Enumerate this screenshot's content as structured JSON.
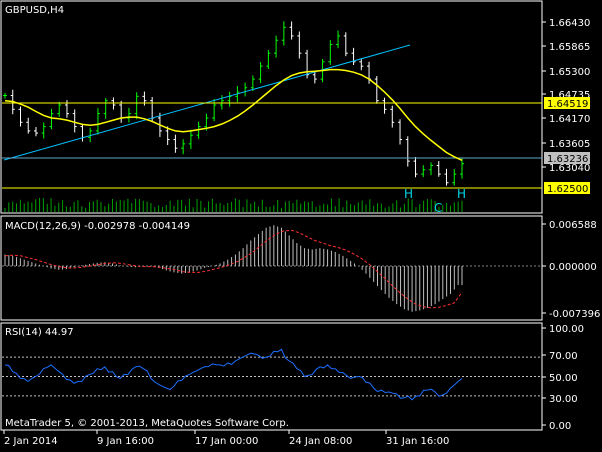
{
  "window": {
    "symbol_label": "GBPUSD,H4"
  },
  "colors": {
    "background": "#000000",
    "frame": "#ffffff",
    "bull_bar": "#00ff00",
    "bear_bar": "#ffffff",
    "ma": "#ffff00",
    "trendline": "#00bfff",
    "hline": "#ffff00",
    "volume": "#00a000",
    "macd_hist": "#c0c0c0",
    "macd_signal": "#ff3030",
    "rsi": "#1e6fff",
    "pattern_label": "#00d5e5",
    "price_tag_bg": "#ffff00",
    "price_tag_current_bg": "#c0c0c0"
  },
  "price_axis": {
    "labels": [
      "1.66430",
      "1.65865",
      "1.65300",
      "1.64735",
      "1.64170",
      "1.63605",
      "1.63040"
    ],
    "tags": [
      {
        "value": "1.64519",
        "style": "level"
      },
      {
        "value": "1.63236",
        "style": "current"
      },
      {
        "value": "1.62500",
        "style": "level"
      }
    ]
  },
  "pattern_labels": [
    "H",
    "C",
    "H"
  ],
  "macd": {
    "title": "MACD(12,26,9) -0.002978 -0.004149",
    "axis_labels": [
      "0.006588",
      "0.000000",
      "-0.007396"
    ]
  },
  "rsi": {
    "title": "RSI(14) 44.97",
    "axis_labels": [
      "100.00",
      "70.00",
      "50.00",
      "30.00",
      "0.00"
    ]
  },
  "copyright": "MetaTrader 5, © 2001-2013, MetaQuotes Software Corp.",
  "time_axis": [
    "2 Jan 2014",
    "9 Jan 16:00",
    "17 Jan 00:00",
    "24 Jan 08:00",
    "31 Jan 16:00"
  ],
  "chart_data": {
    "type": "line",
    "close_path": [
      1.6482,
      1.645,
      1.642,
      1.64,
      1.6395,
      1.641,
      1.644,
      1.646,
      1.644,
      1.641,
      1.6385,
      1.64,
      1.644,
      1.647,
      1.646,
      1.643,
      1.644,
      1.648,
      1.647,
      1.643,
      1.64,
      1.638,
      1.636,
      1.637,
      1.639,
      1.641,
      1.643,
      1.646,
      1.647,
      1.648,
      1.649,
      1.65,
      1.652,
      1.655,
      1.658,
      1.661,
      1.664,
      1.662,
      1.658,
      1.653,
      1.652,
      1.656,
      1.66,
      1.662,
      1.658,
      1.656,
      1.655,
      1.652,
      1.647,
      1.645,
      1.642,
      1.638,
      1.633,
      1.63,
      1.631,
      1.632,
      1.63,
      1.628,
      1.63,
      1.6324
    ],
    "ma_path": [
      1.647,
      1.6468,
      1.6462,
      1.6455,
      1.6445,
      1.6436,
      1.643,
      1.6428,
      1.6425,
      1.642,
      1.6415,
      1.6413,
      1.6415,
      1.642,
      1.6425,
      1.643,
      1.6432,
      1.6432,
      1.6428,
      1.6422,
      1.6414,
      1.6406,
      1.64,
      1.6398,
      1.64,
      1.6403,
      1.6406,
      1.641,
      1.6416,
      1.6424,
      1.6434,
      1.6446,
      1.646,
      1.6475,
      1.649,
      1.6505,
      1.6518,
      1.6528,
      1.6534,
      1.6537,
      1.6538,
      1.654,
      1.6542,
      1.6542,
      1.654,
      1.6536,
      1.653,
      1.652,
      1.6506,
      1.649,
      1.6472,
      1.6452,
      1.643,
      1.641,
      1.6393,
      1.6378,
      1.6364,
      1.635,
      1.634,
      1.6332
    ],
    "macd_hist": [
      0.0018,
      0.0016,
      0.0012,
      0.0008,
      0.0004,
      0.0,
      -0.0004,
      -0.0006,
      -0.0005,
      -0.0002,
      0.0001,
      0.0003,
      0.0005,
      0.0006,
      0.0004,
      0.0001,
      -0.0001,
      -0.0002,
      -0.0001,
      0.0,
      -0.0003,
      -0.0007,
      -0.001,
      -0.0012,
      -0.001,
      -0.0007,
      -0.0003,
      0.0,
      0.0004,
      0.001,
      0.0018,
      0.0028,
      0.004,
      0.005,
      0.006,
      0.0064,
      0.006,
      0.0048,
      0.0036,
      0.0028,
      0.0026,
      0.0028,
      0.0026,
      0.0022,
      0.0016,
      0.0008,
      0.0,
      -0.0012,
      -0.0025,
      -0.0038,
      -0.005,
      -0.006,
      -0.0068,
      -0.0072,
      -0.007,
      -0.0066,
      -0.006,
      -0.0052,
      -0.0044,
      -0.003
    ],
    "macd_signal": [
      0.0016,
      0.0017,
      0.0016,
      0.0013,
      0.001,
      0.0006,
      0.0002,
      -0.0001,
      -0.0003,
      -0.0003,
      -0.0002,
      0.0,
      0.0002,
      0.0004,
      0.0005,
      0.0004,
      0.0002,
      0.0,
      -0.0001,
      -0.0001,
      -0.0002,
      -0.0004,
      -0.0006,
      -0.0009,
      -0.001,
      -0.001,
      -0.0008,
      -0.0005,
      -0.0002,
      0.0002,
      0.0007,
      0.0014,
      0.0022,
      0.0032,
      0.0042,
      0.005,
      0.0055,
      0.0056,
      0.0052,
      0.0046,
      0.004,
      0.0036,
      0.0032,
      0.0029,
      0.0025,
      0.0019,
      0.0012,
      0.0003,
      -0.0008,
      -0.0019,
      -0.0031,
      -0.0042,
      -0.0052,
      -0.006,
      -0.0064,
      -0.0066,
      -0.0065,
      -0.0062,
      -0.0058,
      -0.0041
    ],
    "rsi": [
      62,
      55,
      48,
      45,
      50,
      58,
      62,
      55,
      47,
      43,
      45,
      52,
      58,
      60,
      55,
      48,
      52,
      60,
      58,
      48,
      42,
      38,
      40,
      46,
      52,
      56,
      60,
      63,
      62,
      64,
      66,
      70,
      74,
      72,
      70,
      76,
      78,
      66,
      58,
      50,
      52,
      60,
      62,
      58,
      54,
      48,
      50,
      44,
      38,
      36,
      34,
      32,
      28,
      26,
      30,
      36,
      34,
      31,
      38,
      45
    ],
    "rsi_levels": [
      70,
      50,
      30
    ],
    "rsi_ylim": [
      0,
      100
    ],
    "macd_ylim": [
      -0.007396,
      0.006588
    ],
    "price_ylim": [
      1.624,
      1.668
    ]
  }
}
